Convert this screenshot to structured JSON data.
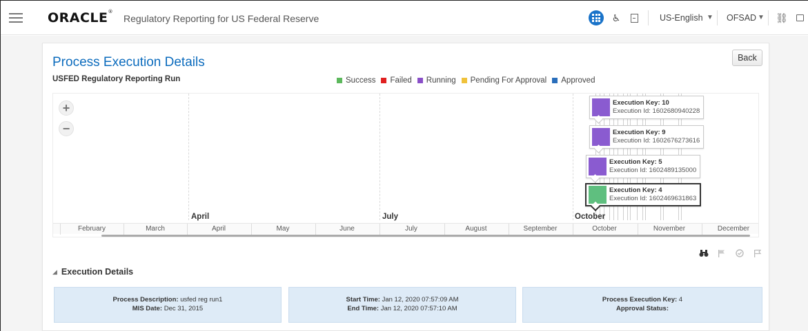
{
  "header": {
    "logo_text": "ORACLE",
    "logo_mark": "®",
    "app_title": "Regulatory Reporting for US Federal Reserve",
    "language": "US-English",
    "user": "OFSAD",
    "caret": "▼"
  },
  "page": {
    "title": "Process Execution Details",
    "back_label": "Back",
    "run_name": "USFED Regulatory Reporting Run"
  },
  "legend": [
    {
      "label": "Success",
      "color": "#5cb85c"
    },
    {
      "label": "Failed",
      "color": "#e02020"
    },
    {
      "label": "Running",
      "color": "#8a4fc8"
    },
    {
      "label": "Pending For Approval",
      "color": "#f0c23b"
    },
    {
      "label": "Approved",
      "color": "#2a6ebb"
    }
  ],
  "timeline": {
    "zoom_in": "+",
    "zoom_out": "−",
    "major_labels": [
      "April",
      "July",
      "October"
    ],
    "minor_labels": [
      "February",
      "March",
      "April",
      "May",
      "June",
      "July",
      "August",
      "September",
      "October",
      "November",
      "December"
    ],
    "executions": [
      {
        "key_label": "Execution Key: 10",
        "id_label": "Execution Id: 1602680940228",
        "color": "#8a5bd0",
        "selected": false
      },
      {
        "key_label": "Execution Key: 9",
        "id_label": "Execution Id: 1602676273616",
        "color": "#8a5bd0",
        "selected": false
      },
      {
        "key_label": "Execution Key: 5",
        "id_label": "Execution Id: 1602489135000",
        "color": "#8a5bd0",
        "selected": false
      },
      {
        "key_label": "Execution Key: 4",
        "id_label": "Execution Id: 1602469631863",
        "color": "#5fbf7f",
        "selected": true
      }
    ]
  },
  "toolbar_icons": [
    "binoculars-icon",
    "flag-icon",
    "check-circle-icon",
    "flag-outline-icon"
  ],
  "execution_details": {
    "section_title": "Execution Details",
    "toggle": "◢",
    "panels": [
      {
        "l1": "Process Description:",
        "v1": "usfed reg run1",
        "l2": "MIS Date:",
        "v2": "Dec 31, 2015"
      },
      {
        "l1": "Start Time:",
        "v1": "Jan 12, 2020 07:57:09 AM",
        "l2": "End Time:",
        "v2": "Jan 12, 2020 07:57:10 AM"
      },
      {
        "l1": "Process Execution Key:",
        "v1": "4",
        "l2": "Approval Status:",
        "v2": ""
      }
    ]
  }
}
